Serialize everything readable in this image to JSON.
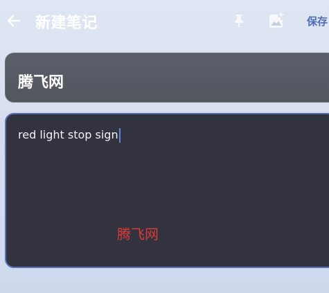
{
  "topbar": {
    "back_icon": "arrow-left-icon",
    "title": "新建笔记",
    "pin_icon": "pin-icon",
    "image_icon": "add-image-icon",
    "save_label": "保存"
  },
  "note": {
    "title_value": "腾飞网",
    "content_value": "red light stop sign"
  },
  "watermark": {
    "text": "腾飞网"
  },
  "colors": {
    "accent": "#4f6eb7",
    "focus_border": "#5571b8",
    "watermark": "#d93b3b"
  }
}
